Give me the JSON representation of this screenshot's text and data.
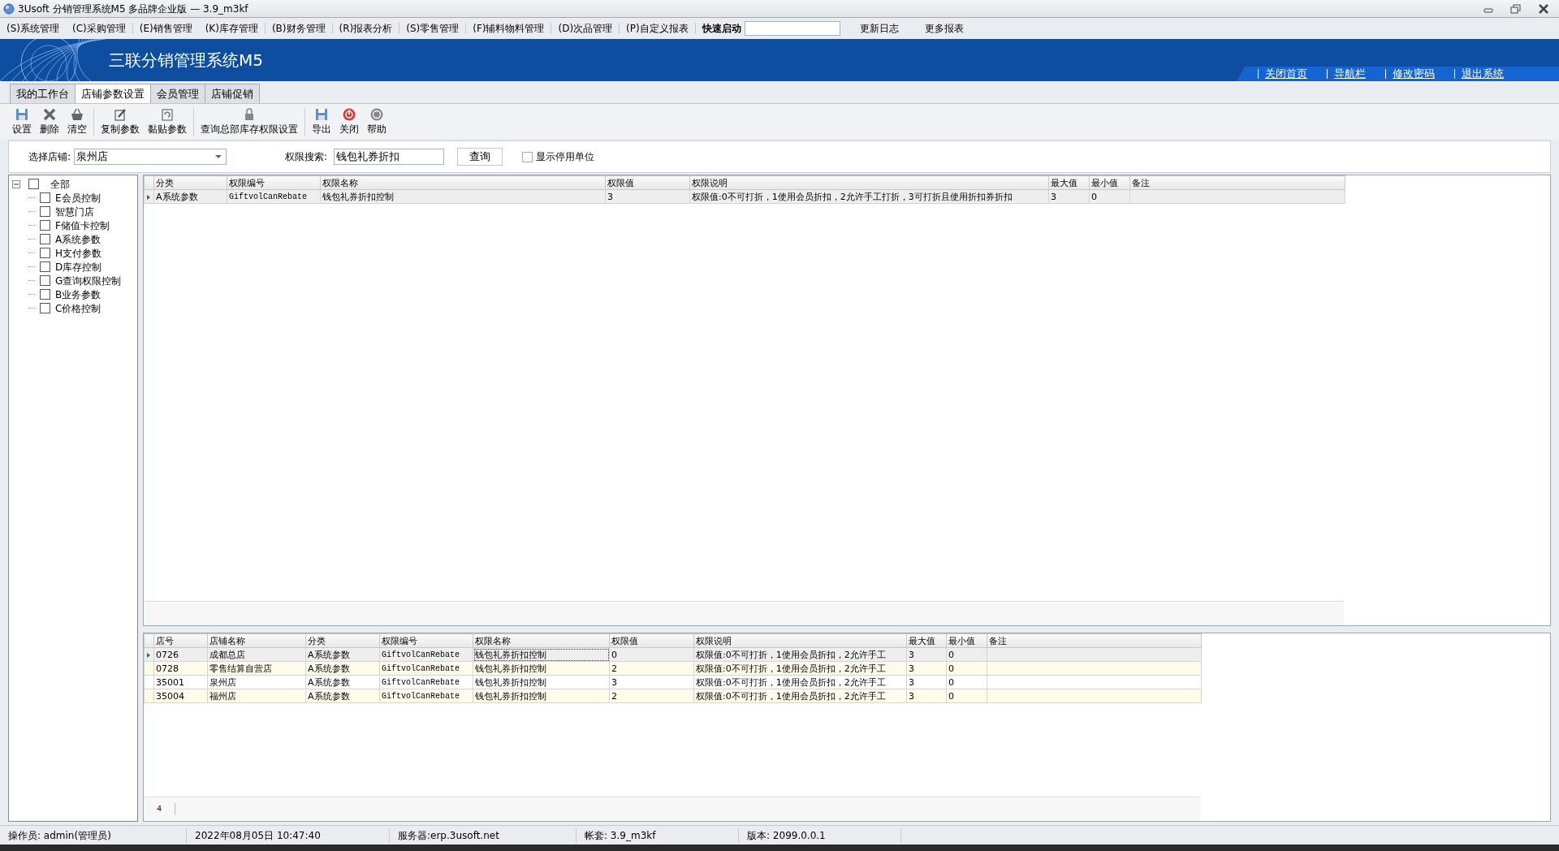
{
  "window": {
    "title": "3Usoft 分销管理系统M5 多品牌企业版 — 3.9_m3kf"
  },
  "menu": [
    {
      "label": "(S)系统管理"
    },
    {
      "label": "(C)采购管理"
    },
    {
      "label": "(E)销售管理"
    },
    {
      "label": "(K)库存管理"
    },
    {
      "label": "(B)财务管理"
    },
    {
      "label": "(R)报表分析"
    },
    {
      "label": "(S)零售管理"
    },
    {
      "label": "(F)辅料物料管理"
    },
    {
      "label": "(D)次品管理"
    },
    {
      "label": "(P)自定义报表"
    }
  ],
  "quick_launch": {
    "label": "快速启动"
  },
  "menu_extra": [
    "更新日志",
    "更多报表"
  ],
  "banner": {
    "title": "三联分销管理系统M5",
    "links": [
      "关闭首页",
      "导航栏",
      "修改密码",
      "退出系统"
    ]
  },
  "tabs": [
    {
      "label": "我的工作台",
      "selected": false
    },
    {
      "label": "店铺参数设置",
      "selected": true
    },
    {
      "label": "会员管理",
      "selected": false
    },
    {
      "label": "店铺促销",
      "selected": false
    }
  ],
  "toolbar_groups": [
    {
      "items": [
        {
          "label": "设置",
          "kind": "save"
        },
        {
          "label": "删除",
          "kind": "delete"
        },
        {
          "label": "清空",
          "kind": "basket"
        }
      ]
    },
    {
      "items": [
        {
          "label": "复制参数",
          "kind": "edit"
        },
        {
          "label": "黏贴参数",
          "kind": "paste"
        }
      ]
    },
    {
      "items": [
        {
          "label": "查询总部库存权限设置",
          "kind": "lock"
        }
      ]
    },
    {
      "items": [
        {
          "label": "导出",
          "kind": "save"
        },
        {
          "label": "关闭",
          "kind": "power"
        },
        {
          "label": "帮助",
          "kind": "help"
        }
      ]
    }
  ],
  "filter": {
    "store": {
      "label": "选择店铺:",
      "value": "泉州店"
    },
    "search": {
      "label": "权限搜索:",
      "value": "钱包礼券折扣"
    },
    "query_button": "查询",
    "show_disabled": {
      "label": "显示停用单位",
      "checked": false
    }
  },
  "tree": {
    "label": "全部",
    "expanded": true,
    "checked": false,
    "children": [
      {
        "label": "E会员控制",
        "checked": false
      },
      {
        "label": "智慧门店",
        "checked": false
      },
      {
        "label": "F储值卡控制",
        "checked": false
      },
      {
        "label": "A系统参数",
        "checked": false
      },
      {
        "label": "H支付参数",
        "checked": false
      },
      {
        "label": "D库存控制",
        "checked": false
      },
      {
        "label": "G查询权限控制",
        "checked": false
      },
      {
        "label": "B业务参数",
        "checked": false
      },
      {
        "label": "C价格控制",
        "checked": false
      }
    ]
  },
  "top_grid": {
    "columns": [
      "分类",
      "权限编号",
      "权限名称",
      "权限值",
      "权限说明",
      "最大值",
      "最小值",
      "备注"
    ],
    "rows": [
      {
        "selected": true,
        "cells": [
          "A系统参数",
          "GiftvolCanRebate",
          "钱包礼券折扣控制",
          "3",
          "权限值:0不可打折，1使用会员折扣，2允许手工打折，3可打折且使用折扣券折扣",
          "3",
          "0",
          ""
        ]
      }
    ]
  },
  "bottom_grid": {
    "columns": [
      "店号",
      "店铺名称",
      "分类",
      "权限编号",
      "权限名称",
      "权限值",
      "权限说明",
      "最大值",
      "最小值",
      "备注"
    ],
    "rows": [
      {
        "selected": true,
        "cells": [
          "0726",
          "成都总店",
          "A系统参数",
          "GiftvolCanRebate",
          "钱包礼券折扣控制",
          "0",
          "权限值:0不可打折，1使用会员折扣，2允许手工",
          "3",
          "0",
          ""
        ]
      },
      {
        "selected": false,
        "cells": [
          "0728",
          "零售结算自营店",
          "A系统参数",
          "GiftvolCanRebate",
          "钱包礼券折扣控制",
          "2",
          "权限值:0不可打折，1使用会员折扣，2允许手工",
          "3",
          "0",
          ""
        ]
      },
      {
        "selected": false,
        "cells": [
          "35001",
          "泉州店",
          "A系统参数",
          "GiftvolCanRebate",
          "钱包礼券折扣控制",
          "3",
          "权限值:0不可打折，1使用会员折扣，2允许手工",
          "3",
          "0",
          ""
        ]
      },
      {
        "selected": false,
        "cells": [
          "35004",
          "福州店",
          "A系统参数",
          "GiftvolCanRebate",
          "钱包礼券折扣控制",
          "2",
          "权限值:0不可打折，1使用会员折扣，2允许手工",
          "3",
          "0",
          ""
        ]
      }
    ],
    "footer_count": "4"
  },
  "status_bar": [
    "操作员: admin(管理员)",
    "2022年08月05日 10:47:40",
    "服务器:erp.3usoft.net",
    "帐套: 3.9_m3kf",
    "版本: 2099.0.0.1"
  ]
}
